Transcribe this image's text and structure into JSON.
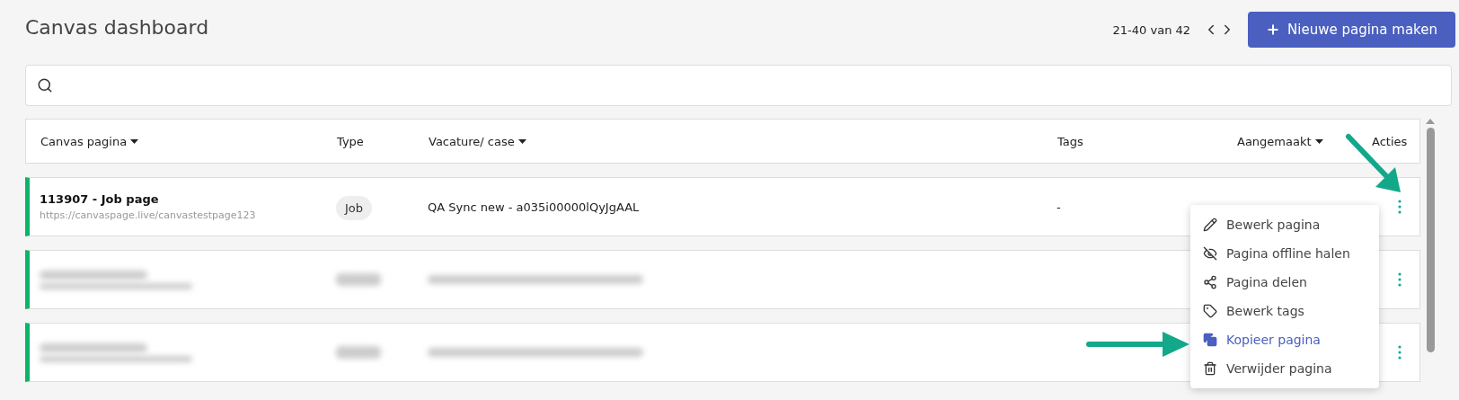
{
  "title": "Canvas dashboard",
  "pagination": {
    "range": "21-40 van 42"
  },
  "new_button": {
    "label": "Nieuwe pagina maken"
  },
  "table": {
    "columns": [
      {
        "label": "Canvas pagina",
        "sortable": true
      },
      {
        "label": "Type",
        "sortable": false
      },
      {
        "label": "Vacature/ case",
        "sortable": true
      },
      {
        "label": "Tags",
        "sortable": false
      },
      {
        "label": "Aangemaakt",
        "sortable": true
      },
      {
        "label": "Acties",
        "sortable": false
      }
    ],
    "rows": [
      {
        "kind": "visible",
        "name": "113907 - Job page",
        "url": "https://canvaspage.live/canvastestpage123",
        "type": "Job",
        "case": "QA Sync new - a035i00000lQyJgAAL",
        "tags": "-"
      },
      {
        "kind": "blurred"
      },
      {
        "kind": "blurred"
      }
    ]
  },
  "action_menu": {
    "items": [
      {
        "label": "Bewerk pagina",
        "selected": false
      },
      {
        "label": "Pagina offline halen",
        "selected": false
      },
      {
        "label": "Pagina delen",
        "selected": false
      },
      {
        "label": "Bewerk tags",
        "selected": false
      },
      {
        "label": "Kopieer pagina",
        "selected": true
      },
      {
        "label": "Verwijder pagina",
        "selected": false
      }
    ]
  }
}
